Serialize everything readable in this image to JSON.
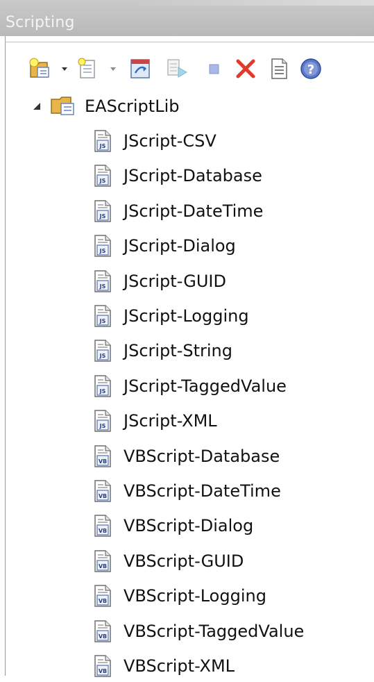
{
  "panel": {
    "title": "Scripting"
  },
  "toolbar": {
    "buttons": [
      {
        "icon": "new-group-icon",
        "dropdown": true
      },
      {
        "icon": "new-script-icon",
        "dropdown": true
      },
      {
        "icon": "refresh-icon"
      },
      {
        "icon": "run-script-icon"
      },
      {
        "icon": "stop-icon"
      },
      {
        "icon": "delete-icon"
      },
      {
        "icon": "properties-icon"
      },
      {
        "icon": "help-icon"
      }
    ]
  },
  "tree": {
    "root": {
      "label": "EAScriptLib",
      "expanded": true
    },
    "items": [
      {
        "label": "JScript-CSV",
        "lang": "JS"
      },
      {
        "label": "JScript-Database",
        "lang": "JS"
      },
      {
        "label": "JScript-DateTime",
        "lang": "JS"
      },
      {
        "label": "JScript-Dialog",
        "lang": "JS"
      },
      {
        "label": "JScript-GUID",
        "lang": "JS"
      },
      {
        "label": "JScript-Logging",
        "lang": "JS"
      },
      {
        "label": "JScript-String",
        "lang": "JS"
      },
      {
        "label": "JScript-TaggedValue",
        "lang": "JS"
      },
      {
        "label": "JScript-XML",
        "lang": "JS"
      },
      {
        "label": "VBScript-Database",
        "lang": "VB"
      },
      {
        "label": "VBScript-DateTime",
        "lang": "VB"
      },
      {
        "label": "VBScript-Dialog",
        "lang": "VB"
      },
      {
        "label": "VBScript-GUID",
        "lang": "VB"
      },
      {
        "label": "VBScript-Logging",
        "lang": "VB"
      },
      {
        "label": "VBScript-TaggedValue",
        "lang": "VB"
      },
      {
        "label": "VBScript-XML",
        "lang": "VB"
      }
    ]
  }
}
